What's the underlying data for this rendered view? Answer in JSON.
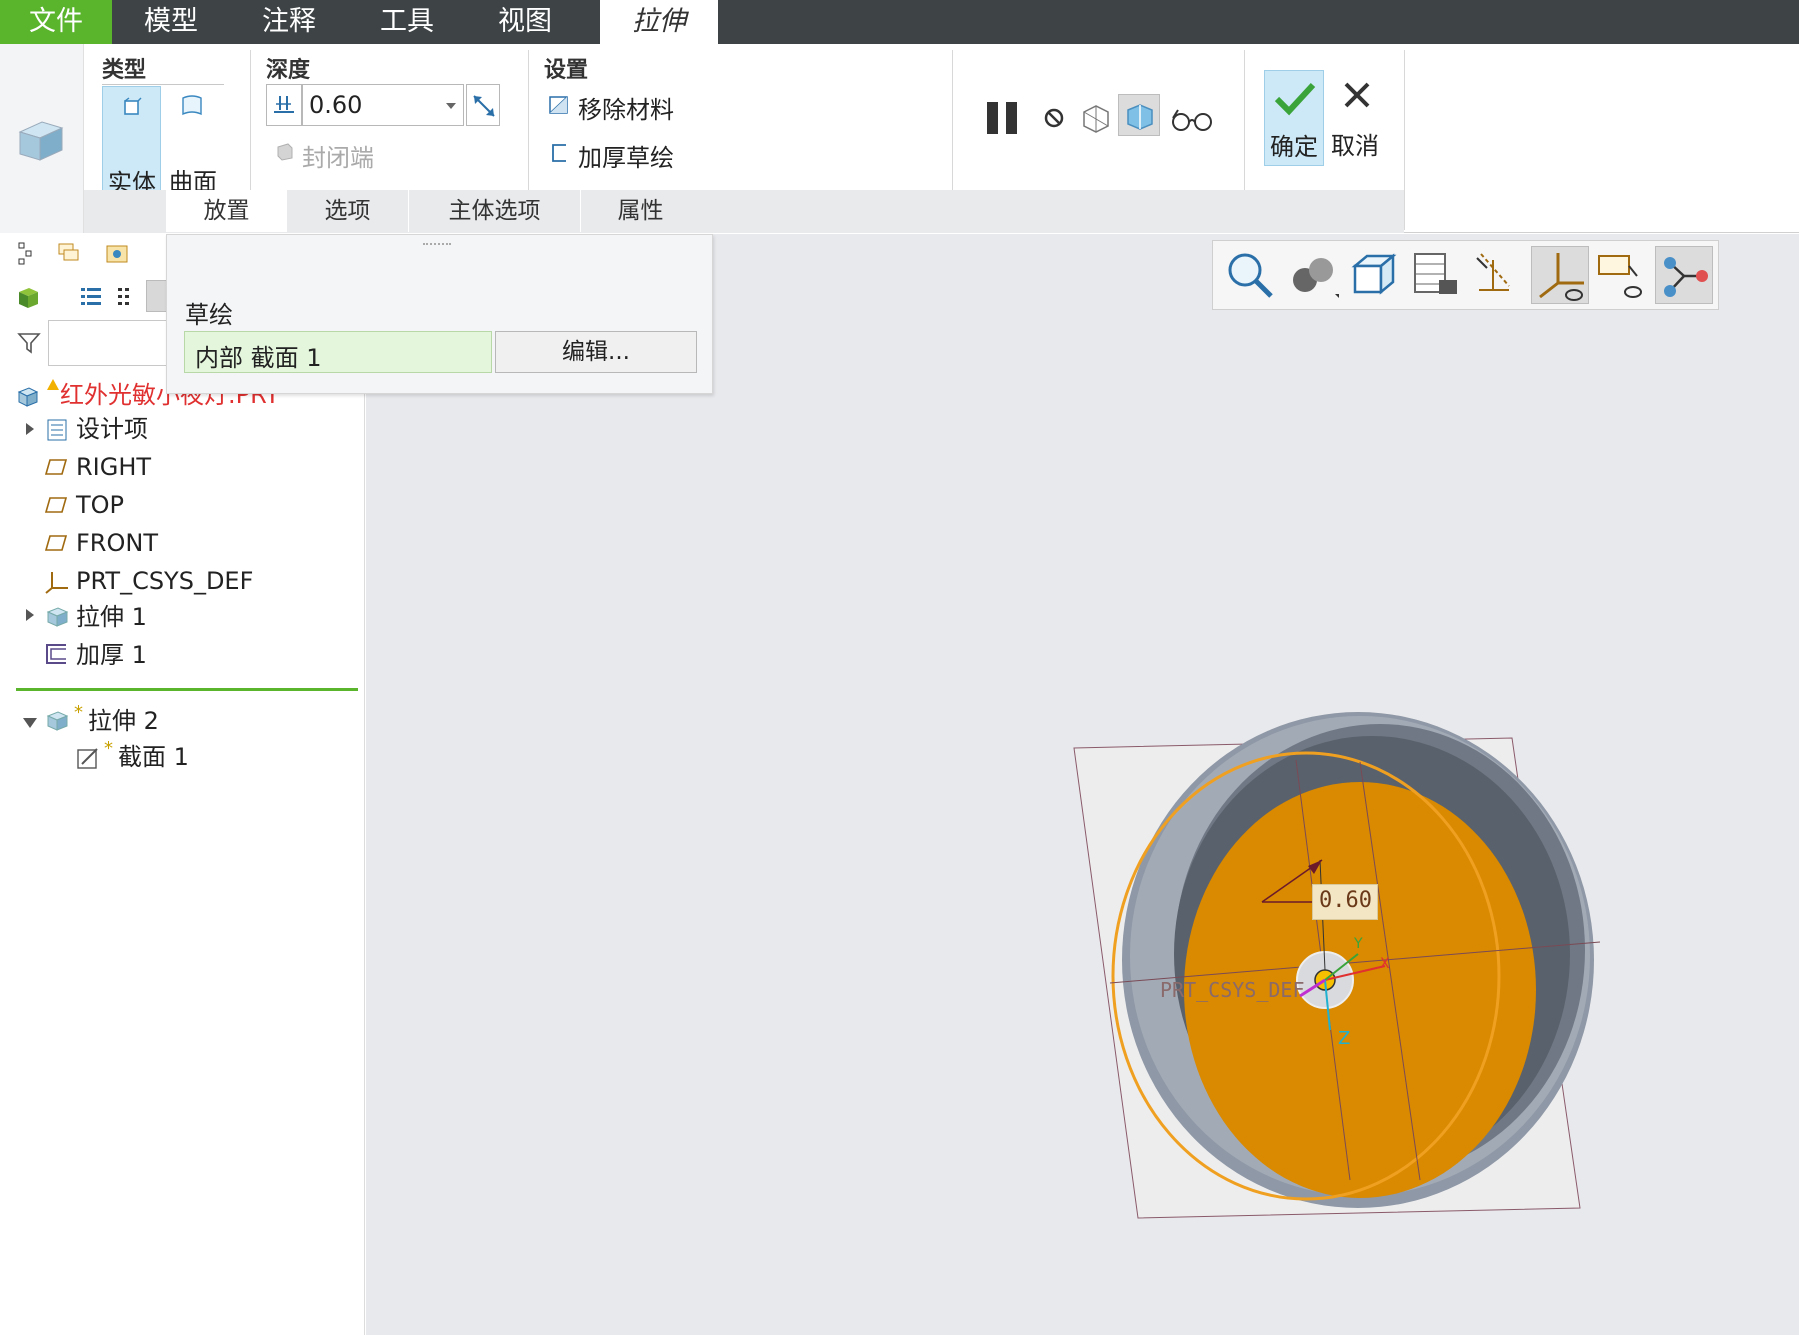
{
  "menu": {
    "tabs": [
      "文件",
      "模型",
      "注释",
      "工具",
      "视图",
      "拉伸"
    ]
  },
  "ribbon": {
    "type_group": {
      "label": "类型",
      "solid": "实体",
      "surface": "曲面"
    },
    "depth_group": {
      "label": "深度",
      "value": "0.60",
      "capped_ends": "封闭端"
    },
    "settings_group": {
      "label": "设置",
      "remove_material": "移除材料",
      "thicken_sketch": "加厚草绘"
    },
    "confirm": "确定",
    "cancel": "取消",
    "subtabs": [
      "放置",
      "选项",
      "主体选项",
      "属性"
    ]
  },
  "placement_panel": {
    "sketch_label": "草绘",
    "sketch_value": "内部 截面 1",
    "edit_button": "编辑..."
  },
  "model_tree": {
    "root": "红外光敏小夜灯.PRT",
    "items": [
      "设计项",
      "RIGHT",
      "TOP",
      "FRONT",
      "PRT_CSYS_DEF",
      "拉伸 1",
      "加厚 1"
    ],
    "new_feature": "拉伸 2",
    "new_feature_child": "截面 1",
    "new_marker": "*"
  },
  "viewport": {
    "dimension": "0.60",
    "csys_label": "PRT_CSYS_DEF",
    "axis_z": "Z",
    "axis_y": "Y",
    "axis_x": "X"
  },
  "colors": {
    "accent_green": "#5ab42c",
    "menubar": "#3e4346",
    "active_blue": "#cde9f7",
    "extrude_orange": "#d98a00",
    "root_red": "#e03030"
  }
}
